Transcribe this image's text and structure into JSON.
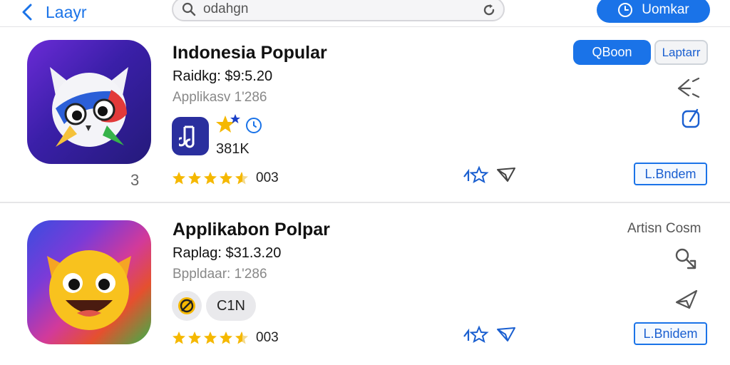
{
  "topbar": {
    "back_label": "Laayr",
    "search_value": "odahgn",
    "search_placeholder": "odahgn",
    "action_label": "Uomkar"
  },
  "apps": [
    {
      "title": "Indonesia Popular",
      "line2": "Raidkg: $9:5.20",
      "line3": "Applikasv 1'286",
      "count": "381K",
      "small_num": "3",
      "rating_count": "003",
      "rating": 4.5,
      "primary_button": "QBoon",
      "secondary_button": "Laptarr",
      "outline_button": "L.Bndem"
    },
    {
      "title": "Applikabon Polpar",
      "line2": "Raplag: $31.3.20",
      "line3": "Bppldaar: 1'286",
      "chip": "C1N",
      "artist": "Artisn Cosm",
      "rating_count": "003",
      "rating": 4.5,
      "outline_button": "L.Bnidem"
    }
  ],
  "colors": {
    "accent": "#1a73e8",
    "star": "#f5b800",
    "divider": "#e6e6e8"
  }
}
